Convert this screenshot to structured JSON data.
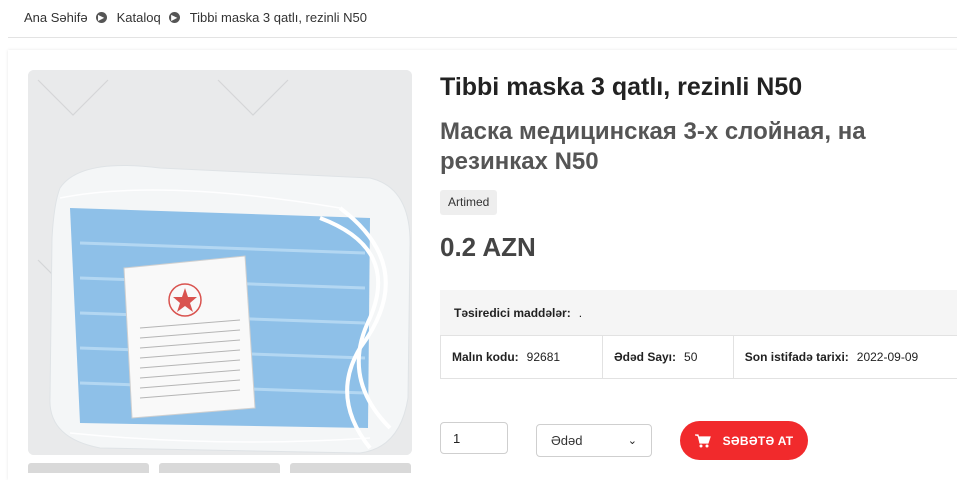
{
  "breadcrumb": [
    {
      "label": "Ana Səhifə"
    },
    {
      "label": "Kataloq"
    },
    {
      "label": "Tibbi maska 3 qatlı, rezinli N50"
    }
  ],
  "product": {
    "title": "Tibbi maska 3 qatlı, rezinli N50",
    "subtitle": "Маска медицинская 3-х слойная, на резинках N50",
    "brand": "Artimed",
    "price": "0.2 AZN",
    "image": {
      "icon": "product-photo-face-mask-pack",
      "background": "#e9eaeb"
    }
  },
  "details": {
    "active_label": "Təsiredici maddələr:",
    "active_value": ".",
    "code_label": "Malın kodu:",
    "code_value": "92681",
    "count_label": "Ədəd Sayı:",
    "count_value": "50",
    "expiry_label": "Son istifadə tarixi:",
    "expiry_value": "2022-09-09"
  },
  "purchase": {
    "quantity_value": "1",
    "unit_selected": "Ədəd",
    "cart_label": "SƏBƏTƏ AT",
    "cart_icon": "cart-icon",
    "cart_color": "#f12a2c"
  }
}
